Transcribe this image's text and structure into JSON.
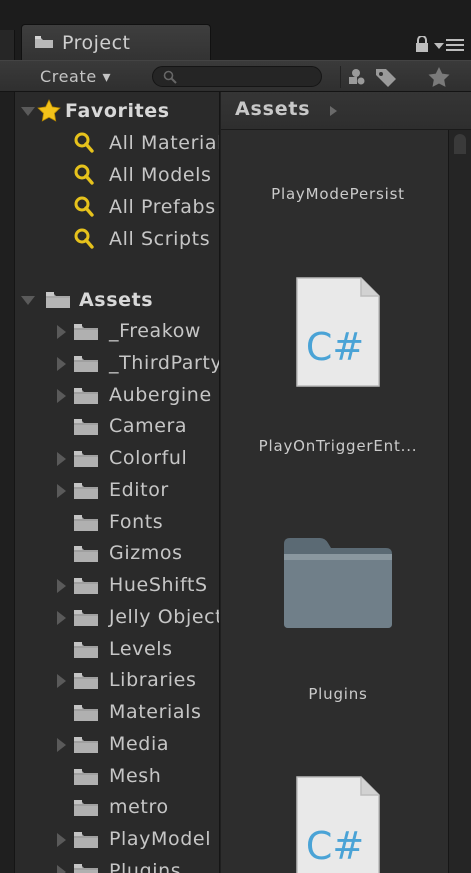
{
  "tab": {
    "label": "Project",
    "icon": "folder-tab-icon"
  },
  "window_controls": {
    "lock": "lock-icon",
    "menu": "panel-menu-icon"
  },
  "toolbar": {
    "create_label": "Create ▾",
    "search_value": "",
    "filter_icons": [
      "type-filter-icon",
      "label-filter-icon",
      "favorites-star-icon"
    ]
  },
  "favorites": {
    "header": "Favorites",
    "items": [
      {
        "label": "All Materials"
      },
      {
        "label": "All Models"
      },
      {
        "label": "All Prefabs"
      },
      {
        "label": "All Scripts"
      }
    ]
  },
  "assets_tree": {
    "header": "Assets",
    "items": [
      {
        "label": "_Freakow",
        "expandable": true
      },
      {
        "label": "_ThirdParty",
        "expandable": true
      },
      {
        "label": "Aubergine",
        "expandable": true
      },
      {
        "label": "Camera",
        "expandable": false
      },
      {
        "label": "Colorful",
        "expandable": true
      },
      {
        "label": "Editor",
        "expandable": true
      },
      {
        "label": "Fonts",
        "expandable": false
      },
      {
        "label": "Gizmos",
        "expandable": false
      },
      {
        "label": "HueShiftS",
        "expandable": true
      },
      {
        "label": "Jelly Objects",
        "expandable": true
      },
      {
        "label": "Levels",
        "expandable": false
      },
      {
        "label": "Libraries",
        "expandable": true
      },
      {
        "label": "Materials",
        "expandable": false
      },
      {
        "label": "Media",
        "expandable": true
      },
      {
        "label": "Mesh",
        "expandable": false
      },
      {
        "label": "metro",
        "expandable": false
      },
      {
        "label": "PlayModel",
        "expandable": true
      },
      {
        "label": "Plugins",
        "expandable": true
      }
    ]
  },
  "grid": {
    "breadcrumb": "Assets",
    "items": [
      {
        "label": "PlayModePersist",
        "kind": "script"
      },
      {
        "label": "PlayOnTriggerEnt...",
        "kind": "script"
      },
      {
        "label": "Plugins",
        "kind": "folder"
      },
      {
        "label": "",
        "kind": "script"
      }
    ],
    "script_glyph": "C#"
  },
  "colors": {
    "panel_bg": "#2a2a2a",
    "grid_bg": "#2d2d2d",
    "favorite_star": "#f2c21a",
    "search_icon": "#e6c21c",
    "csharp_blue": "#4aa3d6"
  }
}
